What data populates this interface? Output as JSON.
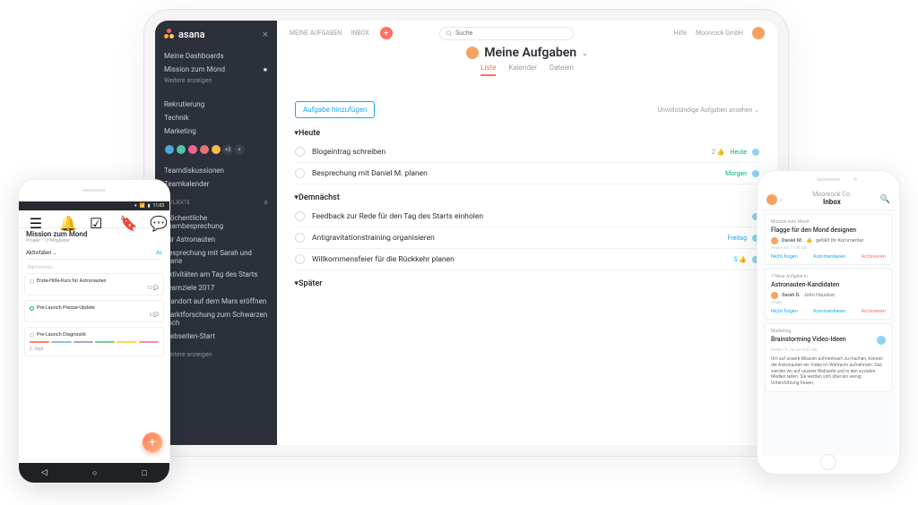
{
  "laptop": {
    "sidebar": {
      "logo": "asana",
      "nav1": [
        "Meine Dashboards"
      ],
      "fav": "Mission zum Mond",
      "showmore1": "Weitere anzeigen",
      "teams": [
        "Rekrutierung",
        "Technik",
        "Marketing"
      ],
      "avatar_more": "+3",
      "nav2": [
        "Teamdiskussionen",
        "Teamkalender"
      ],
      "projects_header": "PROJEKTE",
      "projects": [
        "Wöchentliche Teambesprechung",
        "Für Astronauten",
        "Besprechung mit Sarah und Marie",
        "Aktivitäten am Tag des Starts",
        "Teamziele 2017",
        "Standort auf dem Mars eröffnen",
        "Marktforschung zum Schwarzen Loch",
        "Webseiten-Start"
      ],
      "showmore2": "Weitere anzeigen"
    },
    "topbar": {
      "nav": [
        "MEINE AUFGABEN",
        "INBOX"
      ],
      "search_placeholder": "Suche",
      "help": "Hilfe",
      "org": "Moonrock GmbH"
    },
    "header": {
      "title": "Meine Aufgaben",
      "tabs": [
        "Liste",
        "Kalender",
        "Dateien"
      ]
    },
    "main": {
      "add_task": "Aufgabe hinzufügen",
      "view_option": "Unvollständige Aufgaben ansehen",
      "sections": [
        {
          "title": "Heute",
          "tasks": [
            {
              "name": "Blogeintrag schreiben",
              "likes": "2",
              "date": "Heute",
              "date_cls": "today"
            },
            {
              "name": "Besprechung mit Daniel M. planen",
              "date": "Morgen",
              "date_cls": "tm"
            }
          ]
        },
        {
          "title": "Demnächst",
          "tasks": [
            {
              "name": "Feedback zur Rede für den Tag des Starts einholen"
            },
            {
              "name": "Antigravitationstraining organisieren",
              "date": "Freitag",
              "date_cls": ""
            },
            {
              "name": "Willkommensfeier für die Rückkehr planen",
              "likes": "5",
              "like_active": true
            }
          ]
        },
        {
          "title": "Später",
          "tasks": []
        }
      ]
    }
  },
  "android": {
    "status_time": "11:03",
    "title": "Mission zum Mond",
    "subtitle": "Projekt • 13 Mitglieder",
    "tab": "Aktivitäten",
    "accent": "Ac",
    "input_placeholder": "Nachrichten…",
    "cards": [
      {
        "title": "Erste-Hilfe-Kurs für Astronauten",
        "comments": "12",
        "status": ""
      },
      {
        "title": "Pre-Launch Presse-Update",
        "comments": "6",
        "status": "g"
      },
      {
        "title": "Pre-Launch Diagnostik",
        "date": "2. Sept",
        "status": ""
      }
    ]
  },
  "ios": {
    "header_sub": "Moonrock Co.",
    "header_title": "Inbox",
    "cards": [
      {
        "project": "Mission zum Mond",
        "title": "Flagge für den Mond designen",
        "row_user": "Daniel M.",
        "row_text": "gefällt Ihr Kommentar",
        "meta": "Heute, um 11:39 Uhr",
        "actions": [
          "Nicht folgen",
          "Kommentieren",
          "Archivieren"
        ]
      },
      {
        "project": "1 Neue Aufgabe in",
        "title": "Astronauten-Kandidaten",
        "row_user": "Sarah D.",
        "row_text": "John Houston",
        "meta": "Heute",
        "actions": [
          "Nicht folgen",
          "Kommentieren",
          "Archivieren"
        ]
      },
      {
        "project": "Marketing",
        "title": "Brainstorming Video-Ideen",
        "meta": "Direkt • 9. Jul um 9:30 Uhr",
        "body": "Um auf unsere Mission aufmerksam zu machen, können die Astronauten ein Video im Weltraum aufnehmen. Das werden wir auf unserer Webseite und in den sozialen Medien teilen. Sie werden sich über ein wenig Unterstützung freuen,"
      }
    ]
  }
}
